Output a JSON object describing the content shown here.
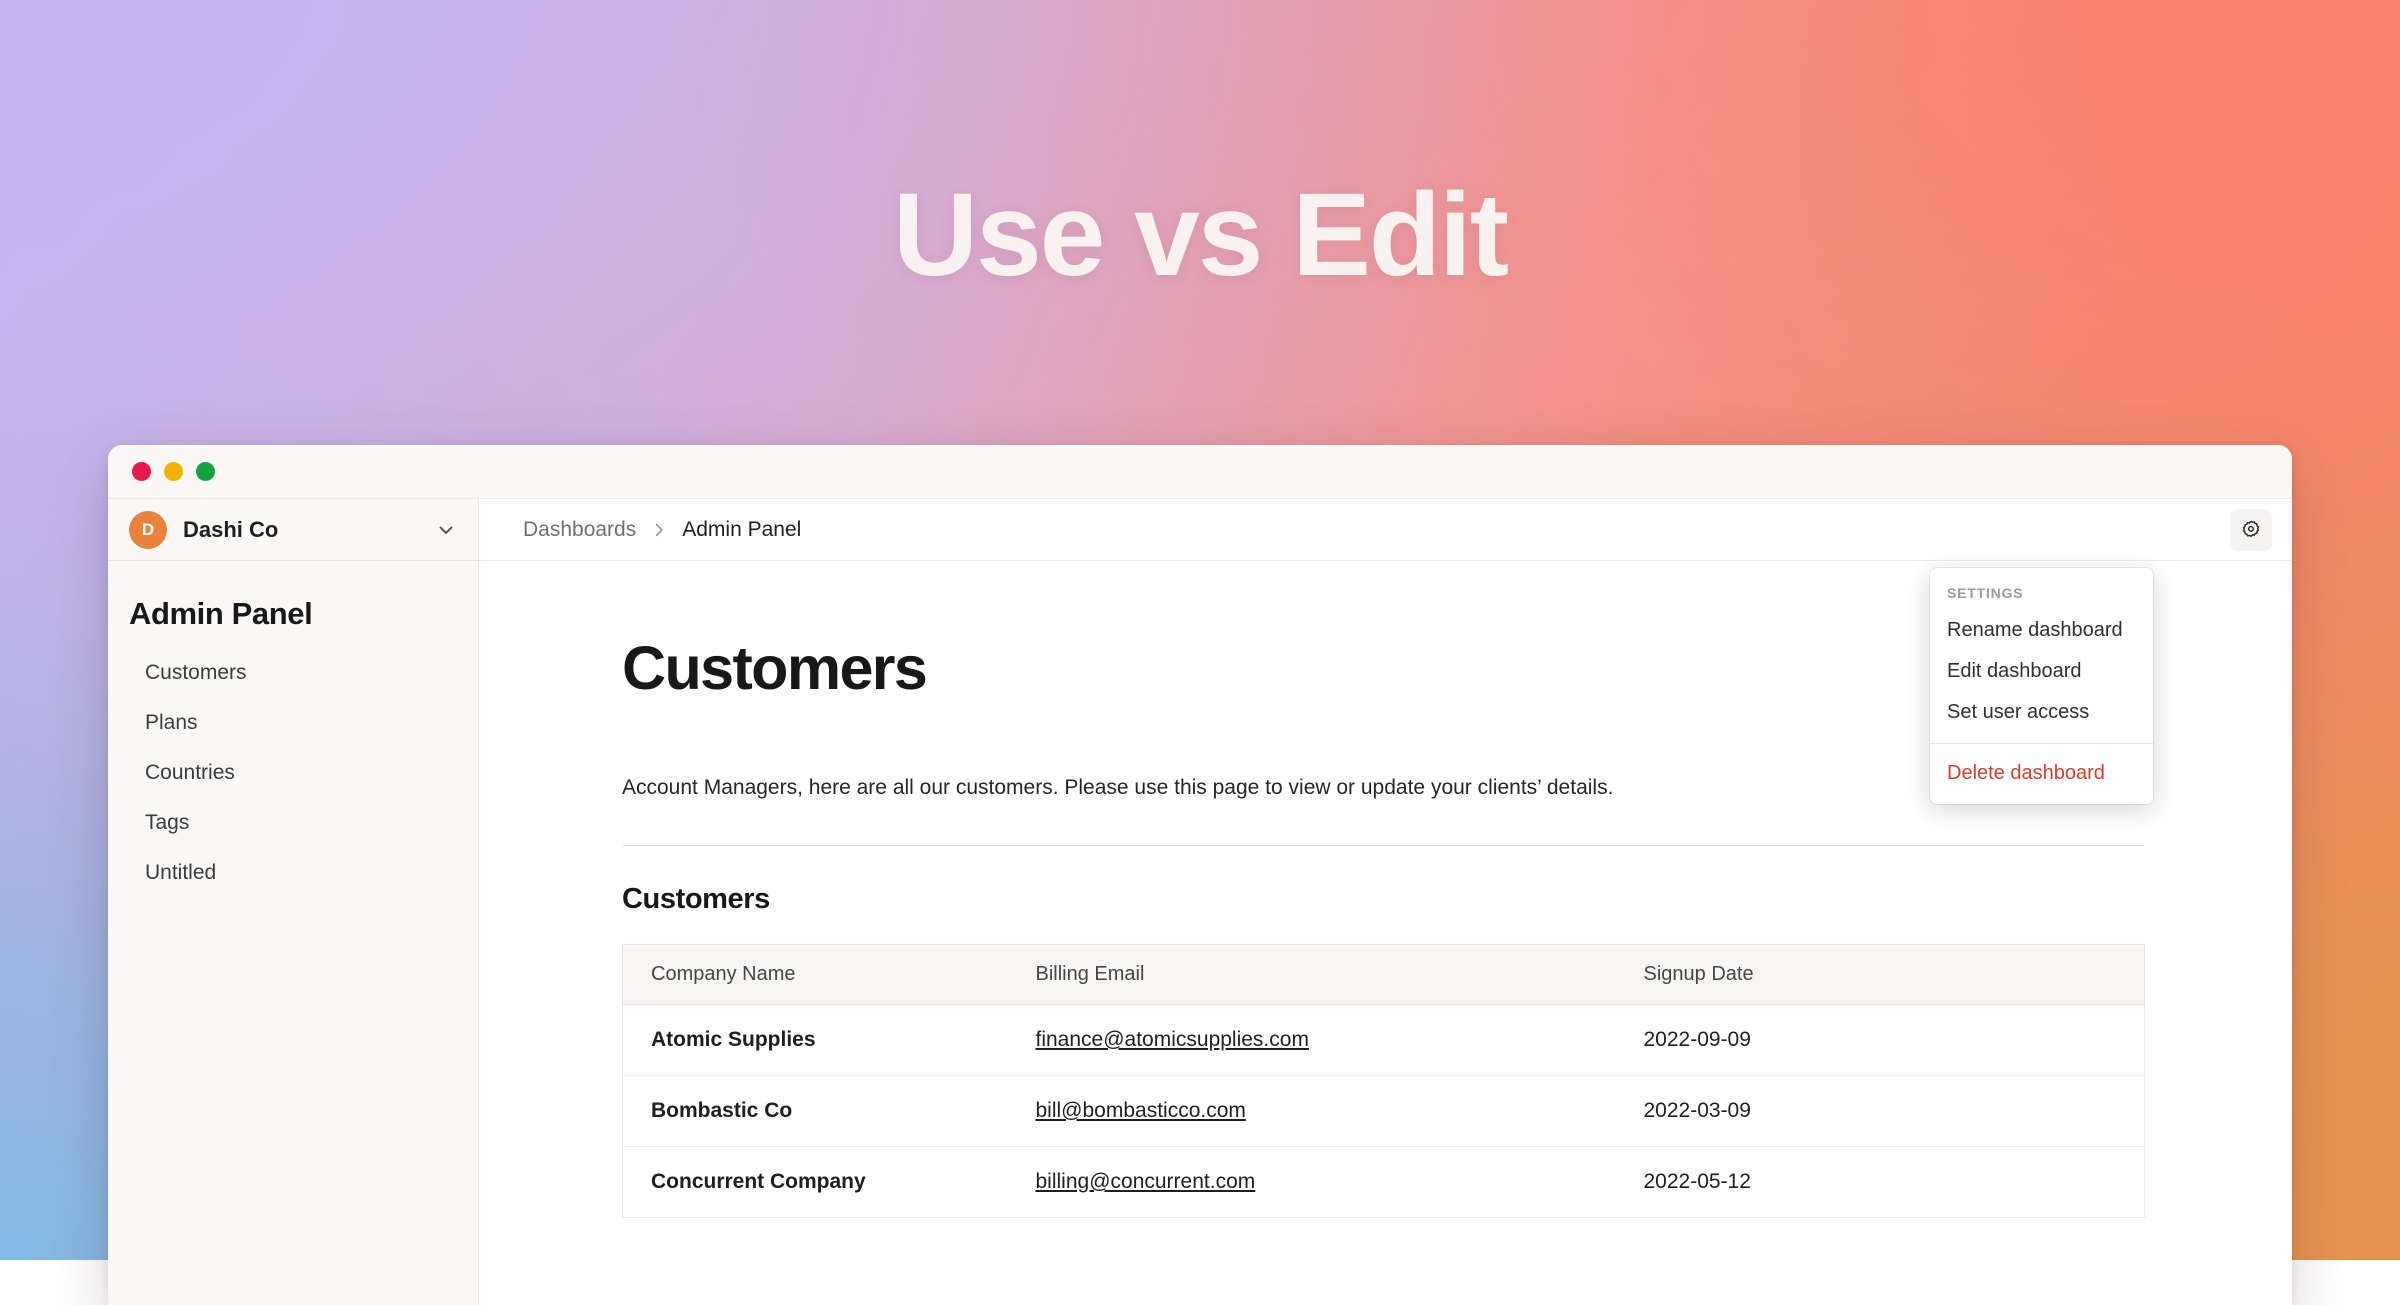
{
  "hero": {
    "title": "Use vs Edit",
    "colors": {
      "top_left": "#c6b4f0",
      "top_right": "#fb826e",
      "bottom_left": "#83b8e4",
      "bottom_right": "#e79450",
      "title_color": "#faf2f0"
    }
  },
  "window": {
    "traffic_lights": [
      {
        "name": "close",
        "color": "#e8194c"
      },
      {
        "name": "minimize",
        "color": "#f0b400"
      },
      {
        "name": "zoom",
        "color": "#14a33d"
      }
    ]
  },
  "sidebar": {
    "org": {
      "avatar_initial": "D",
      "avatar_color": "#e8823c",
      "name": "Dashi Co",
      "chevron_icon": "chevron-down-icon"
    },
    "dashboard_title": "Admin Panel",
    "items": [
      {
        "label": "Customers"
      },
      {
        "label": "Plans"
      },
      {
        "label": "Countries"
      },
      {
        "label": "Tags"
      },
      {
        "label": "Untitled"
      }
    ]
  },
  "topbar": {
    "breadcrumb": [
      {
        "label": "Dashboards",
        "current": false
      },
      {
        "label": "Admin Panel",
        "current": true
      }
    ],
    "separator_icon": "chevron-right-icon",
    "settings_button_icon": "gear-icon"
  },
  "main": {
    "page_title": "Customers",
    "description": "Account Managers, here are all our customers. Please use this page to view or update your clients’ details.",
    "section_title": "Customers",
    "table": {
      "columns": [
        "Company Name",
        "Billing Email",
        "Signup Date"
      ],
      "rows": [
        {
          "company_name": "Atomic Supplies",
          "billing_email": "finance@atomicsupplies.com",
          "signup_date": "2022-09-09"
        },
        {
          "company_name": "Bombastic Co",
          "billing_email": "bill@bombasticco.com",
          "signup_date": "2022-03-09"
        },
        {
          "company_name": "Concurrent Company",
          "billing_email": "billing@concurrent.com",
          "signup_date": "2022-05-12"
        }
      ]
    }
  },
  "settings_menu": {
    "header": "SETTINGS",
    "items": [
      {
        "label": "Rename dashboard",
        "danger": false
      },
      {
        "label": "Edit dashboard",
        "danger": false
      },
      {
        "label": "Set user access",
        "danger": false
      }
    ],
    "danger_item": {
      "label": "Delete dashboard",
      "color": "#d2402f"
    }
  }
}
